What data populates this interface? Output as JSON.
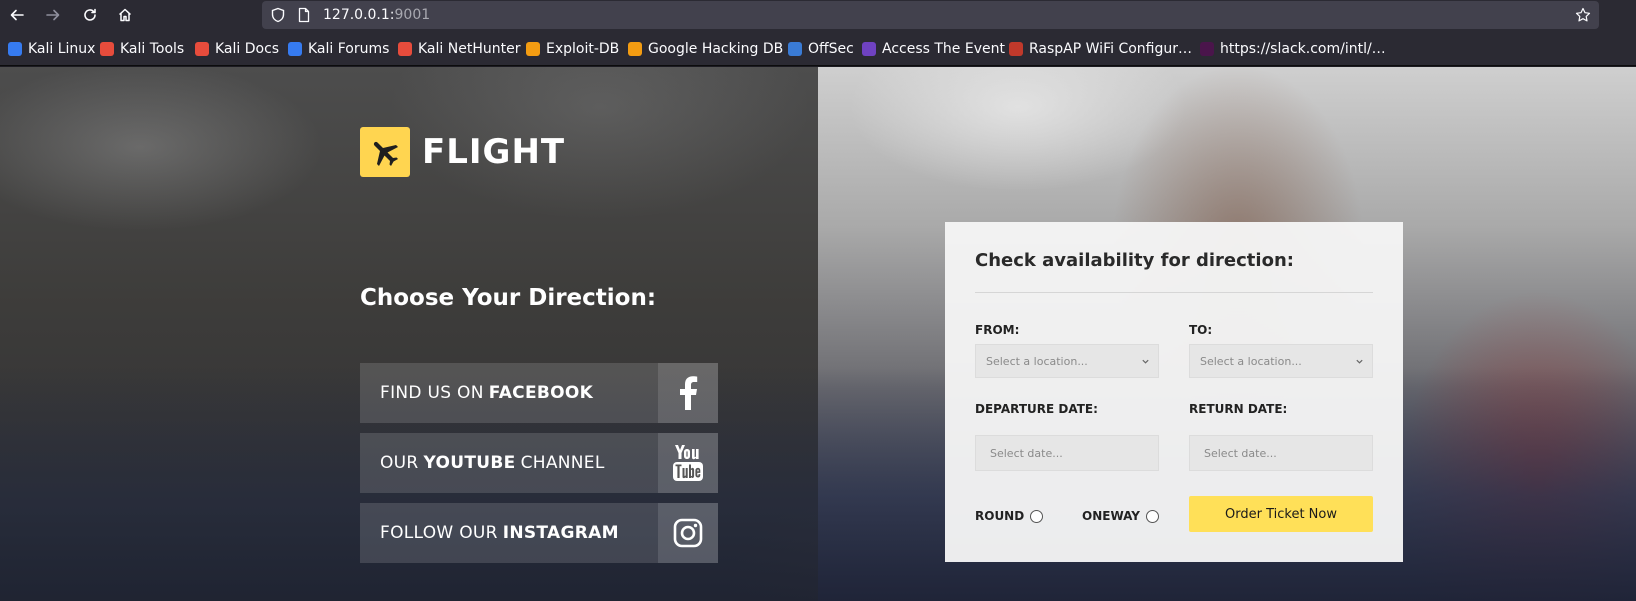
{
  "browser": {
    "url_host": "127.0.0.1:",
    "url_port": "9001",
    "bookmarks": [
      {
        "label": "Kali Linux",
        "icon": "kali-dragon-icon",
        "color": "#367bf0"
      },
      {
        "label": "Kali Tools",
        "icon": "kali-tools-icon",
        "color": "#e74c3c"
      },
      {
        "label": "Kali Docs",
        "icon": "kali-docs-icon",
        "color": "#e74c3c"
      },
      {
        "label": "Kali Forums",
        "icon": "kali-forums-icon",
        "color": "#367bf0"
      },
      {
        "label": "Kali NetHunter",
        "icon": "kali-nethunter-icon",
        "color": "#e74c3c"
      },
      {
        "label": "Exploit-DB",
        "icon": "exploit-db-icon",
        "color": "#f39c12"
      },
      {
        "label": "Google Hacking DB",
        "icon": "google-hacking-db-icon",
        "color": "#f39c12"
      },
      {
        "label": "OffSec",
        "icon": "offsec-icon",
        "color": "#3a7bd5"
      },
      {
        "label": "Access The Event",
        "icon": "access-event-icon",
        "color": "#6f42c1"
      },
      {
        "label": "RaspAP WiFi Configur…",
        "icon": "raspap-icon",
        "color": "#c0392b"
      },
      {
        "label": "https://slack.com/intl/…",
        "icon": "slack-icon",
        "color": "#4a154b"
      }
    ]
  },
  "site": {
    "logo_text": "FLIGHT",
    "accent_color": "#ffd550",
    "choose_title": "Choose Your Direction:",
    "social": [
      {
        "prefix": "FIND US ON",
        "bold": "FACEBOOK",
        "suffix": "",
        "icon": "facebook-icon"
      },
      {
        "prefix": "OUR",
        "bold": "YOUTUBE",
        "suffix": "CHANNEL",
        "icon": "youtube-icon"
      },
      {
        "prefix": "FOLLOW OUR",
        "bold": "INSTAGRAM",
        "suffix": "",
        "icon": "instagram-icon"
      }
    ]
  },
  "booking": {
    "title": "Check availability for direction:",
    "from_label": "FROM:",
    "to_label": "TO:",
    "from_placeholder": "Select a location...",
    "to_placeholder": "Select a location...",
    "departure_label": "DEPARTURE DATE:",
    "return_label": "RETURN DATE:",
    "departure_placeholder": "Select date...",
    "return_placeholder": "Select date...",
    "round_label": "ROUND",
    "oneway_label": "ONEWAY",
    "order_button": "Order Ticket Now",
    "button_color": "#ffe058"
  }
}
